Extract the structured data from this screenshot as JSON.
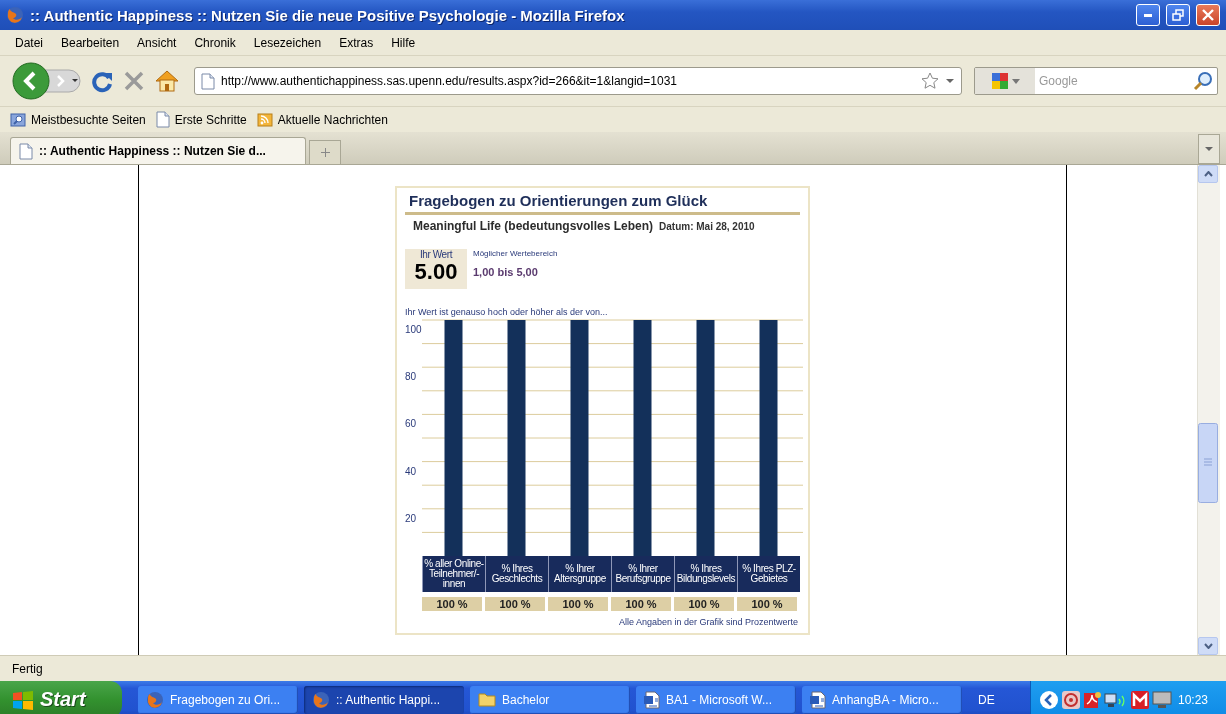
{
  "window": {
    "title": ":: Authentic Happiness :: Nutzen Sie die neue Positive Psychologie - Mozilla Firefox"
  },
  "menu": [
    "Datei",
    "Bearbeiten",
    "Ansicht",
    "Chronik",
    "Lesezeichen",
    "Extras",
    "Hilfe"
  ],
  "toolbar": {
    "url": "http://www.authentichappiness.sas.upenn.edu/results.aspx?id=266&it=1&langid=1031",
    "search_placeholder": "Google"
  },
  "bookmarks": [
    {
      "label": "Meistbesuchte Seiten",
      "kind": "smart"
    },
    {
      "label": "Erste Schritte",
      "kind": "page"
    },
    {
      "label": "Aktuelle Nachrichten",
      "kind": "feed"
    }
  ],
  "tabs": [
    {
      "label": ":: Authentic Happiness :: Nutzen Sie d...",
      "selected": true
    }
  ],
  "page": {
    "title": "Fragebogen zu Orientierungen zum Glück",
    "subtitle": "Meaningful Life (bedeutungsvolles Leben)",
    "date": "Datum: Mai 28, 2010",
    "score_label": "Ihr Wert",
    "score": "5.00",
    "range_label": "Möglicher Wertebereich",
    "range": "1,00 bis 5,00",
    "compare_text": "Ihr Wert ist genauso hoch oder höher als der von...",
    "chart_data": {
      "type": "bar",
      "categories": [
        "% aller Online-Teilnehmer/-innen",
        "% Ihres Geschlechts",
        "% Ihrer Altersgruppe",
        "% Ihrer Berufsgruppe",
        "% Ihres Bildungslevels",
        "% Ihres PLZ-Gebietes"
      ],
      "series": [
        {
          "color": "#13305a",
          "values": [
            100,
            100,
            100,
            100,
            100,
            100
          ]
        }
      ],
      "grid": true,
      "ylim": [
        0,
        100
      ],
      "yticks": [
        20,
        40,
        60,
        80,
        100
      ],
      "value_labels": [
        "100 %",
        "100 %",
        "100 %",
        "100 %",
        "100 %",
        "100 %"
      ]
    },
    "footnote": "Alle Angaben in der Grafik sind Prozentwerte"
  },
  "status": "Fertig",
  "taskbar": {
    "start": "Start",
    "items": [
      {
        "label": "Fragebogen zu Ori...",
        "kind": "firefox",
        "selected": false
      },
      {
        "label": ":: Authentic Happi...",
        "kind": "firefox",
        "selected": true
      },
      {
        "label": "Bachelor",
        "kind": "folder",
        "selected": false
      },
      {
        "label": "BA1 - Microsoft W...",
        "kind": "word",
        "selected": false
      },
      {
        "label": "AnhangBA - Micro...",
        "kind": "word",
        "selected": false
      }
    ],
    "language": "DE",
    "clock": "10:23"
  }
}
